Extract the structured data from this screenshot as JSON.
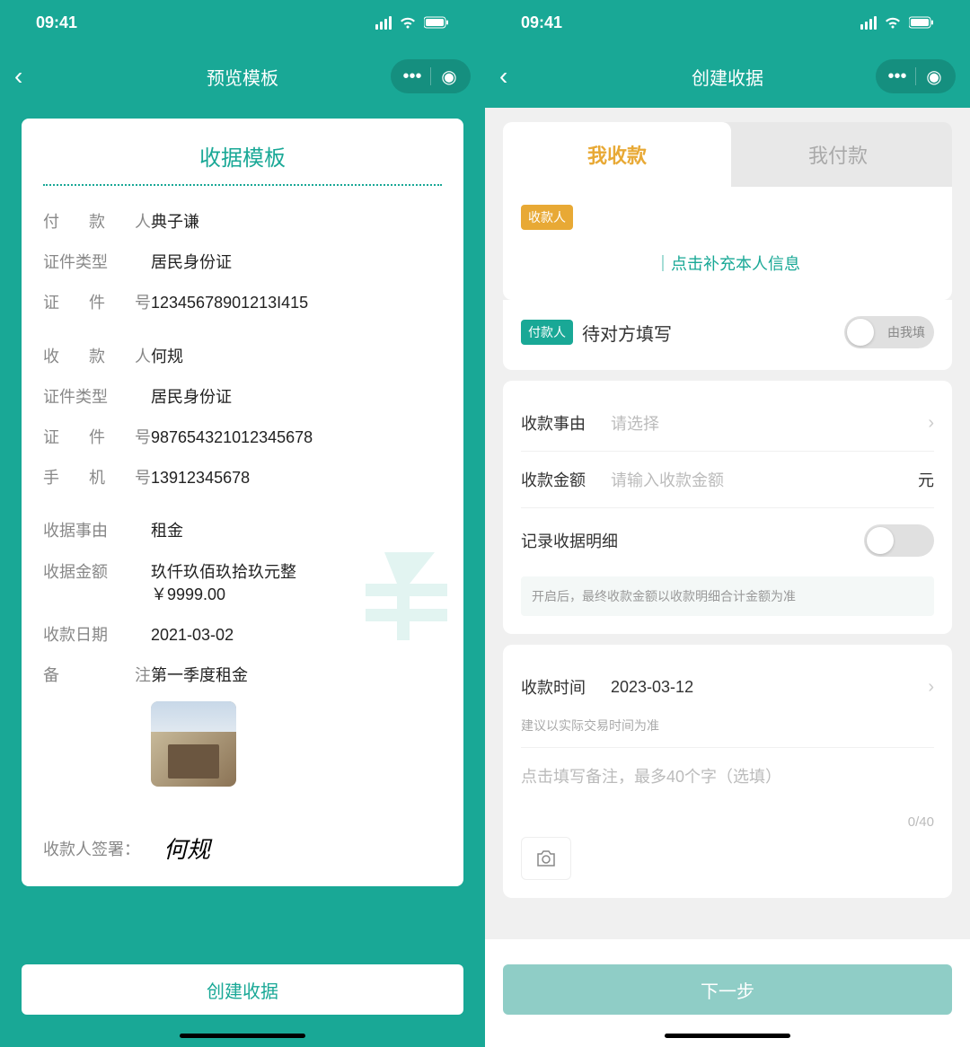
{
  "left": {
    "status_time": "09:41",
    "nav_title": "预览模板",
    "card_title": "收据模板",
    "payer_label": "付款人",
    "payer_value": "典子谦",
    "idtype_label": "证件类型",
    "idtype_value": "居民身份证",
    "idno_label": "证件号",
    "idno_value": "12345678901213I415",
    "payee_label": "收款人",
    "payee_value": "何规",
    "idtype2_label": "证件类型",
    "idtype2_value": "居民身份证",
    "idno2_label": "证件号",
    "idno2_value": "987654321012345678",
    "phone_label": "手机号",
    "phone_value": "13912345678",
    "reason_label": "收据事由",
    "reason_value": "租金",
    "amount_label": "收据金额",
    "amount_text": "玖仟玖佰玖拾玖元整",
    "amount_num": "￥9999.00",
    "date_label": "收款日期",
    "date_value": "2021-03-02",
    "remark_label": "备注",
    "remark_value": "第一季度租金",
    "sign_label": "收款人签署：",
    "sign_value": "何规",
    "bottom_btn": "创建收据"
  },
  "right": {
    "status_time": "09:41",
    "nav_title": "创建收据",
    "tab1": "我收款",
    "tab2": "我付款",
    "badge_payee": "收款人",
    "fill_link": "｜点击补充本人信息",
    "badge_payer": "付款人",
    "payer_wait": "待对方填写",
    "toggle_fill_text": "由我填",
    "reason_label": "收款事由",
    "reason_placeholder": "请选择",
    "amount_label": "收款金额",
    "amount_placeholder": "请输入收款金额",
    "amount_unit": "元",
    "detail_label": "记录收据明细",
    "detail_hint": "开启后，最终收款金额以收款明细合计金额为准",
    "time_label": "收款时间",
    "time_value": "2023-03-12",
    "time_hint": "建议以实际交易时间为准",
    "note_placeholder": "点击填写备注，最多40个字（选填）",
    "char_count": "0/40",
    "bottom_btn": "下一步"
  }
}
